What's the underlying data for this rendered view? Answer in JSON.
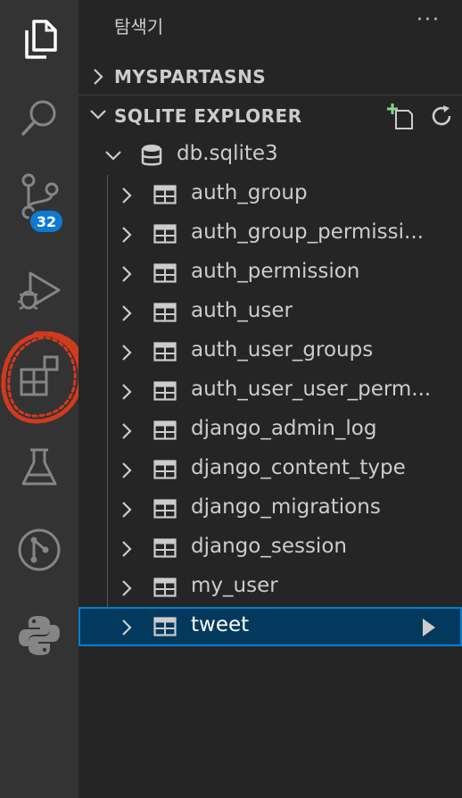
{
  "sidebar": {
    "title": "탐색기",
    "more": "···",
    "sections": {
      "project": {
        "label": "MYSPARTASNS"
      },
      "sqlite": {
        "label": "SQLITE EXPLORER"
      }
    },
    "database": {
      "name": "db.sqlite3"
    },
    "tables": [
      {
        "name": "auth_group"
      },
      {
        "name": "auth_group_permissi..."
      },
      {
        "name": "auth_permission"
      },
      {
        "name": "auth_user"
      },
      {
        "name": "auth_user_groups"
      },
      {
        "name": "auth_user_user_perm..."
      },
      {
        "name": "django_admin_log"
      },
      {
        "name": "django_content_type"
      },
      {
        "name": "django_migrations"
      },
      {
        "name": "django_session"
      },
      {
        "name": "my_user"
      },
      {
        "name": "tweet"
      }
    ],
    "selected_table": "tweet"
  },
  "activity_bar": {
    "items": [
      {
        "icon": "files-icon"
      },
      {
        "icon": "search-icon"
      },
      {
        "icon": "source-control-icon",
        "badge": "32"
      },
      {
        "icon": "run-debug-icon"
      },
      {
        "icon": "extensions-icon",
        "highlight": "red hand-drawn circle"
      },
      {
        "icon": "testing-flask-icon"
      },
      {
        "icon": "git-graph-icon"
      },
      {
        "icon": "python-icon"
      }
    ]
  },
  "colors": {
    "sidebar_bg": "#252526",
    "activity_bg": "#333333",
    "selection_bg": "#04395e",
    "selection_border": "#007fd4",
    "badge_bg": "#0e7ad2",
    "annotation_red": "#d23a1e"
  }
}
